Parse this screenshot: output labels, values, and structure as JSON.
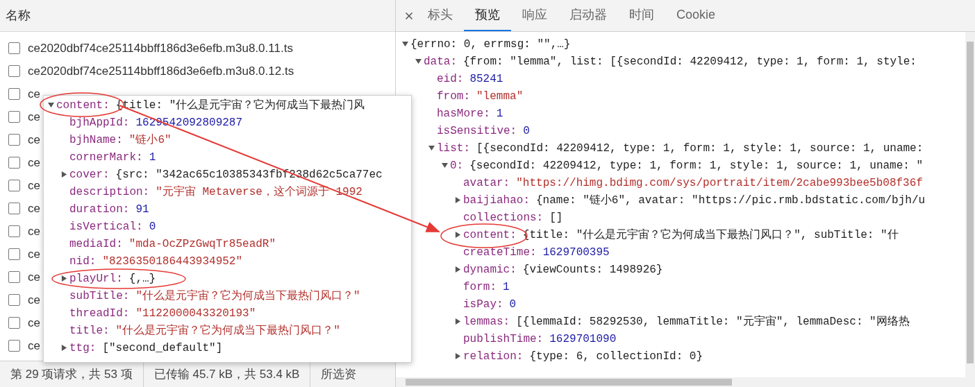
{
  "requests": {
    "header": "名称",
    "rows": [
      {
        "name": "ce2020dbf74ce25114bbff186d3e6efb.m3u8.0.11.ts",
        "checked": false
      },
      {
        "name": "ce2020dbf74ce25114bbff186d3e6efb.m3u8.0.12.ts",
        "checked": false
      },
      {
        "name": "ce",
        "checked": false
      },
      {
        "name": "ce",
        "checked": false
      },
      {
        "name": "ce",
        "checked": false
      },
      {
        "name": "ce",
        "checked": false
      },
      {
        "name": "ce",
        "checked": false
      },
      {
        "name": "ce",
        "checked": false
      },
      {
        "name": "ce",
        "checked": false
      },
      {
        "name": "ce",
        "checked": false
      },
      {
        "name": "ce",
        "checked": false
      },
      {
        "name": "ce",
        "checked": false
      },
      {
        "name": "ce",
        "checked": false
      },
      {
        "name": "ce",
        "checked": false
      }
    ]
  },
  "status_bar": [
    "第 29 项请求，共 53 项",
    "已传输 45.7 kB，共 53.4 kB",
    "所选资"
  ],
  "popup": {
    "tree": [
      {
        "key": "content:",
        "value": "{title: \"什么是元宇宙？它为何成当下最热门风",
        "kind": "object",
        "expanded": true,
        "children": [
          {
            "key": "bjhAppId:",
            "value": "1629542092809287",
            "kind": "number"
          },
          {
            "key": "bjhName:",
            "value": "\"链小6\"",
            "kind": "string"
          },
          {
            "key": "cornerMark:",
            "value": "1",
            "kind": "number"
          },
          {
            "key": "cover:",
            "value": "{src: \"342ac65c10385343fbf238d62c5ca77ec",
            "kind": "object",
            "expanded": false
          },
          {
            "key": "description:",
            "value": "\"元宇宙 Metaverse，这个词源于 1992",
            "kind": "string"
          },
          {
            "key": "duration:",
            "value": "91",
            "kind": "number"
          },
          {
            "key": "isVertical:",
            "value": "0",
            "kind": "number"
          },
          {
            "key": "mediaId:",
            "value": "\"mda-OcZPzGwqTr85eadR\"",
            "kind": "string"
          },
          {
            "key": "nid:",
            "value": "\"8236350186443934952\"",
            "kind": "string"
          },
          {
            "key": "playUrl:",
            "value": "{,…}",
            "kind": "object",
            "expanded": false
          },
          {
            "key": "subTitle:",
            "value": "\"什么是元宇宙？它为何成当下最热门风口？\"",
            "kind": "string"
          },
          {
            "key": "threadId:",
            "value": "\"1122000043320193\"",
            "kind": "string"
          },
          {
            "key": "title:",
            "value": "\"什么是元宇宙？它为何成当下最热门风口？\"",
            "kind": "string"
          },
          {
            "key": "ttg:",
            "value": "[\"second_default\"]",
            "kind": "object",
            "expanded": false
          }
        ]
      }
    ]
  },
  "details": {
    "tabs": [
      {
        "label": "标头",
        "selected": false
      },
      {
        "label": "预览",
        "selected": true
      },
      {
        "label": "响应",
        "selected": false
      },
      {
        "label": "启动器",
        "selected": false
      },
      {
        "label": "时间",
        "selected": false
      },
      {
        "label": "Cookie",
        "selected": false
      }
    ],
    "tree": [
      {
        "value": "{errno: 0, errmsg: \"\",…}",
        "kind": "object",
        "expanded": true,
        "children": [
          {
            "key": "data:",
            "value": "{from: \"lemma\", list: [{secondId: 42209412, type: 1, form: 1, style:",
            "kind": "object",
            "expanded": true,
            "children": [
              {
                "key": "eid:",
                "value": "85241",
                "kind": "number"
              },
              {
                "key": "from:",
                "value": "\"lemma\"",
                "kind": "string"
              },
              {
                "key": "hasMore:",
                "value": "1",
                "kind": "number"
              },
              {
                "key": "isSensitive:",
                "value": "0",
                "kind": "number"
              },
              {
                "key": "list:",
                "value": "[{secondId: 42209412, type: 1, form: 1, style: 1, source: 1, uname:",
                "kind": "object",
                "expanded": true,
                "children": [
                  {
                    "key": "0:",
                    "value": "{secondId: 42209412, type: 1, form: 1, style: 1, source: 1, uname: \"",
                    "kind": "object",
                    "expanded": true,
                    "children": [
                      {
                        "key": "avatar:",
                        "value": "\"https://himg.bdimg.com/sys/portrait/item/2cabe993bee5b08f36f",
                        "kind": "string"
                      },
                      {
                        "key": "baijiahao:",
                        "value": "{name: \"链小6\", avatar: \"https://pic.rmb.bdstatic.com/bjh/u",
                        "kind": "object",
                        "expanded": false
                      },
                      {
                        "key": "collections:",
                        "value": "[]",
                        "kind": "object"
                      },
                      {
                        "key": "content:",
                        "value": "{title: \"什么是元宇宙？它为何成当下最热门风口？\", subTitle: \"什",
                        "kind": "object",
                        "expanded": false
                      },
                      {
                        "key": "createTime:",
                        "value": "1629700395",
                        "kind": "number"
                      },
                      {
                        "key": "dynamic:",
                        "value": "{viewCounts: 1498926}",
                        "kind": "object",
                        "expanded": false
                      },
                      {
                        "key": "form:",
                        "value": "1",
                        "kind": "number"
                      },
                      {
                        "key": "isPay:",
                        "value": "0",
                        "kind": "number"
                      },
                      {
                        "key": "lemmas:",
                        "value": "[{lemmaId: 58292530, lemmaTitle: \"元宇宙\", lemmaDesc: \"网络热",
                        "kind": "object",
                        "expanded": false
                      },
                      {
                        "key": "publishTime:",
                        "value": "1629701090",
                        "kind": "number"
                      },
                      {
                        "key": "relation:",
                        "value": "{type: 6, collectionId: 0}",
                        "kind": "object",
                        "expanded": false
                      }
                    ]
                  }
                ]
              }
            ]
          }
        ]
      }
    ]
  }
}
